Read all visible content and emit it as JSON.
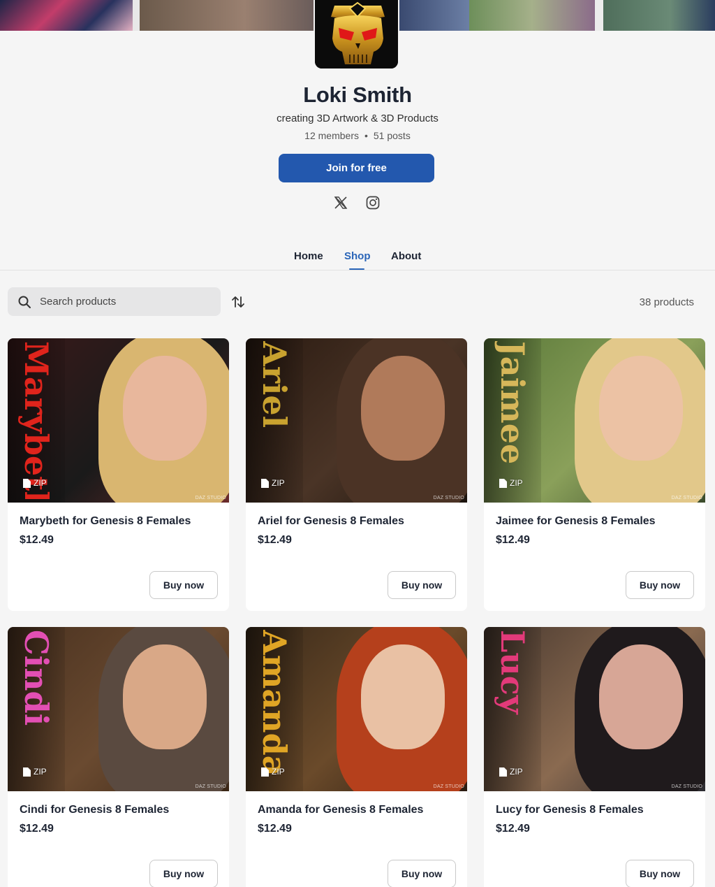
{
  "creator": {
    "name": "Loki Smith",
    "tagline": "creating 3D Artwork & 3D Products",
    "members": "12 members",
    "posts": "51 posts",
    "separator": "•",
    "join_label": "Join for free"
  },
  "social": [
    "x-icon",
    "instagram-icon"
  ],
  "tabs": [
    {
      "label": "Home",
      "active": false
    },
    {
      "label": "Shop",
      "active": true
    },
    {
      "label": "About",
      "active": false
    }
  ],
  "shop": {
    "search_placeholder": "Search products",
    "product_count": "38 products",
    "zip_label": "ZIP",
    "watermark": "DAZ STUDIO",
    "buy_label": "Buy now",
    "products": [
      {
        "title": "Marybeth for Genesis 8 Females",
        "price": "$12.49",
        "side_text": "Marybeth",
        "side_color": "#e0241c"
      },
      {
        "title": "Ariel for Genesis 8 Females",
        "price": "$12.49",
        "side_text": "Ariel",
        "side_color": "#c9a22f"
      },
      {
        "title": "Jaimee for Genesis 8 Females",
        "price": "$12.49",
        "side_text": "Jaimee",
        "side_color": "#d6b75a"
      },
      {
        "title": "Cindi for Genesis 8 Females",
        "price": "$12.49",
        "side_text": "Cindi",
        "side_color": "#e34fb4"
      },
      {
        "title": "Amanda for Genesis 8 Females",
        "price": "$12.49",
        "side_text": "Amanda",
        "side_color": "#e0a525"
      },
      {
        "title": "Lucy for Genesis 8 Females",
        "price": "$12.49",
        "side_text": "Lucy",
        "side_color": "#e23a7a"
      }
    ]
  },
  "colors": {
    "accent": "#2358ae",
    "active_tab": "#2a65b8",
    "page_bg": "#f5f5f5"
  }
}
